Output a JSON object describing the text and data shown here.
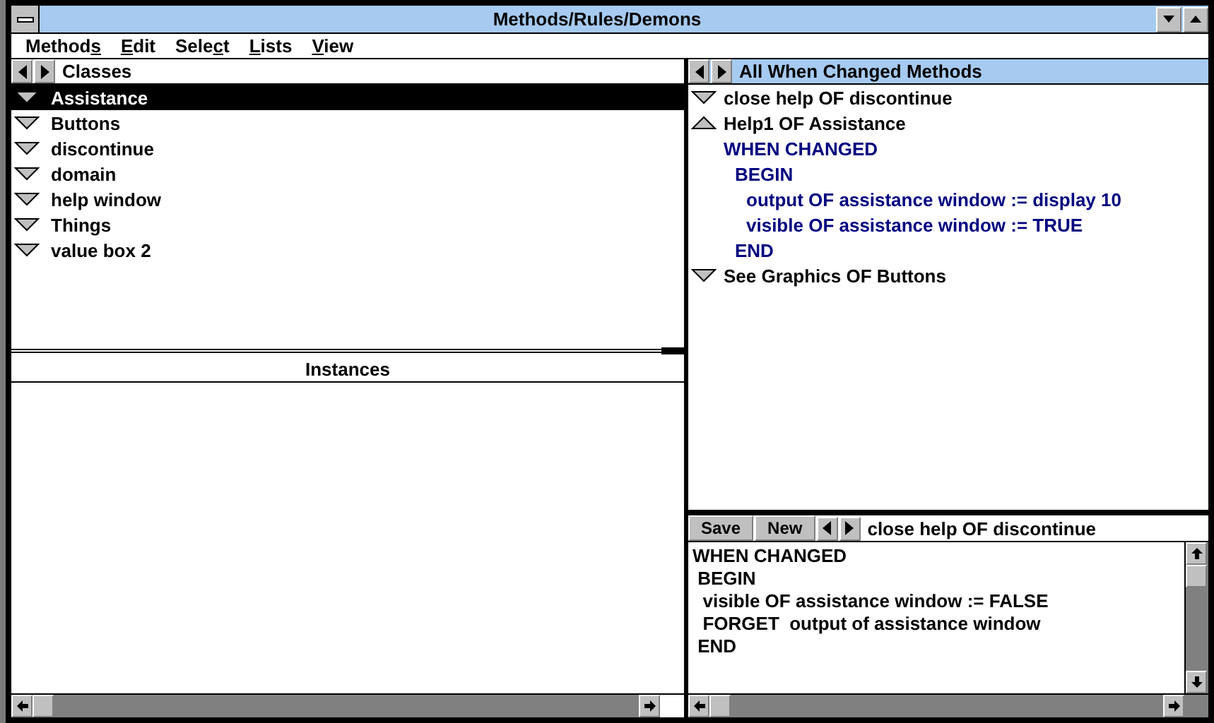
{
  "window": {
    "title": "Methods/Rules/Demons"
  },
  "menu": [
    {
      "before": "Method",
      "mnemonic": "s"
    },
    {
      "mnemonic": "E",
      "after": "dit"
    },
    {
      "before": "Sele",
      "mnemonic": "c",
      "after": "t"
    },
    {
      "mnemonic": "L",
      "after": "ists"
    },
    {
      "mnemonic": "V",
      "after": "iew"
    }
  ],
  "classes": {
    "title": "Classes",
    "items": [
      {
        "label": "Assistance",
        "selected": true,
        "expanded": false
      },
      {
        "label": "Buttons",
        "selected": false,
        "expanded": false
      },
      {
        "label": "discontinue",
        "selected": false,
        "expanded": false
      },
      {
        "label": "domain",
        "selected": false,
        "expanded": false
      },
      {
        "label": "help window",
        "selected": false,
        "expanded": false
      },
      {
        "label": "Things",
        "selected": false,
        "expanded": false
      },
      {
        "label": "value box 2",
        "selected": false,
        "expanded": false
      }
    ]
  },
  "instances": {
    "title": "Instances"
  },
  "methods": {
    "title": "All When Changed Methods",
    "items": [
      {
        "label": "close help OF discontinue",
        "expanded": false
      },
      {
        "label": "Help1 OF Assistance",
        "expanded": true,
        "children": [
          {
            "label": "WHEN CHANGED",
            "children": [
              {
                "label": "BEGIN",
                "children": [
                  {
                    "label": "output OF assistance window := display 10"
                  },
                  {
                    "label": "visible OF assistance window := TRUE"
                  }
                ]
              },
              {
                "label": "END"
              }
            ]
          }
        ]
      },
      {
        "label": "See Graphics OF Buttons",
        "expanded": false
      }
    ]
  },
  "editor": {
    "buttons": [
      "Save",
      "New"
    ],
    "method_name": "close help OF discontinue",
    "lines": [
      "WHEN CHANGED",
      " BEGIN",
      "  visible OF assistance window := FALSE",
      "  FORGET  output of assistance window",
      " END"
    ]
  }
}
